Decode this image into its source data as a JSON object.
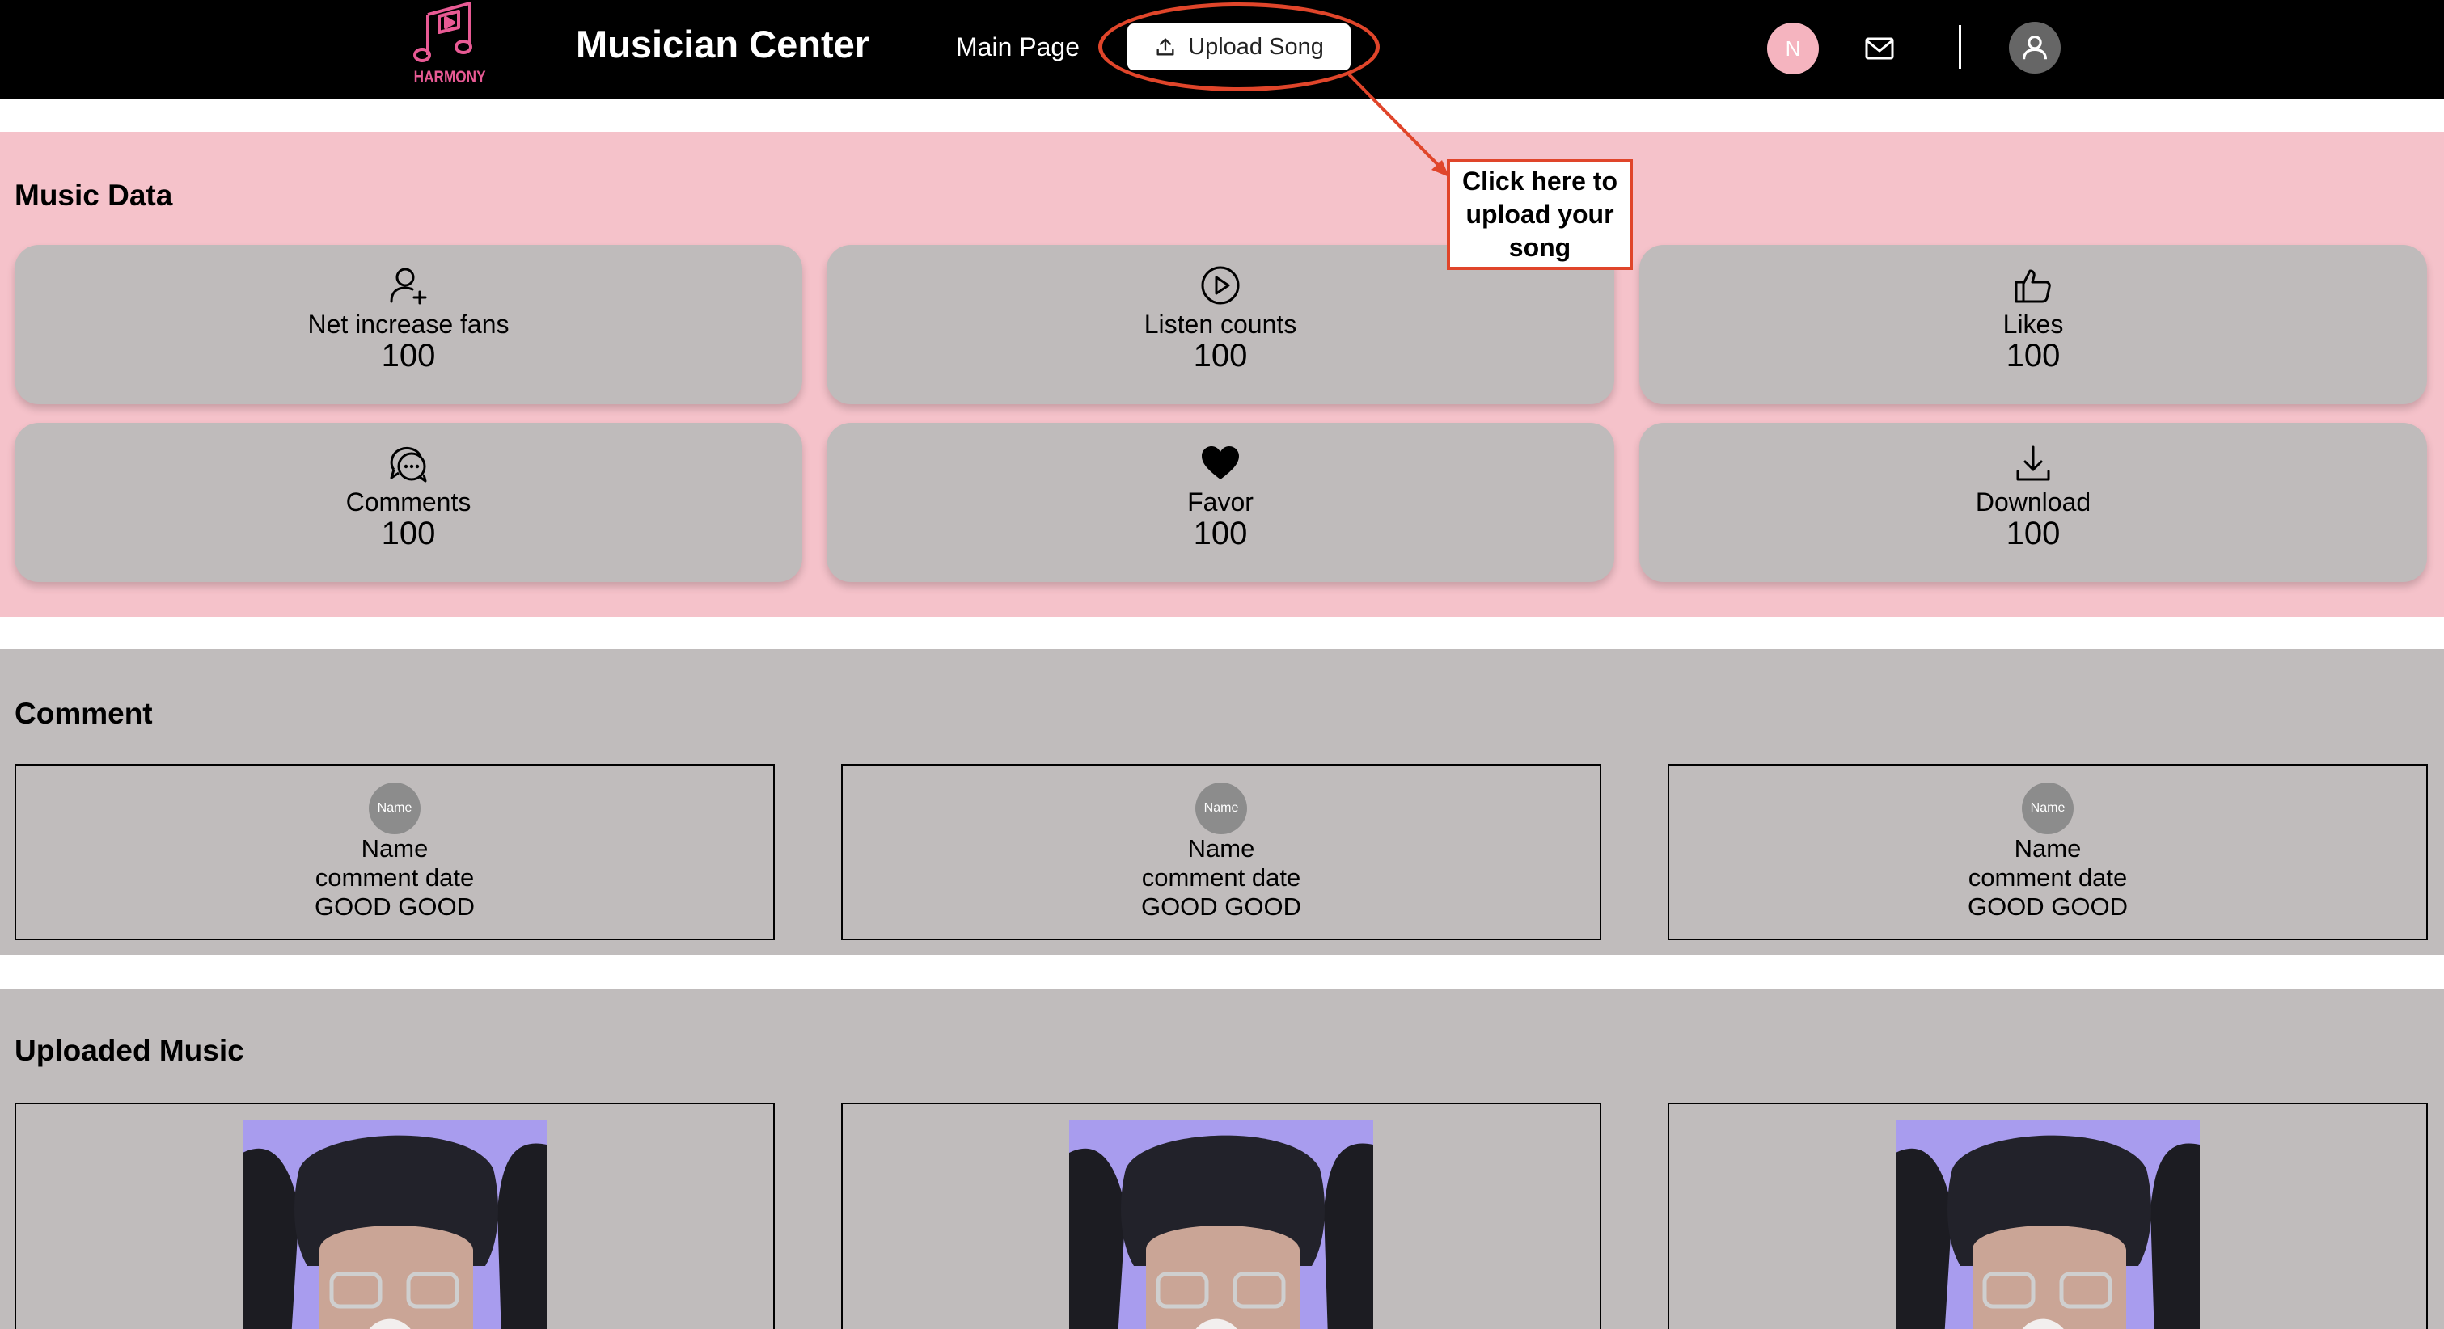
{
  "header": {
    "logo_text": "HARMONY",
    "app_title": "Musician Center",
    "nav_main": "Main Page",
    "upload_button": "Upload Song",
    "avatar_initial": "N"
  },
  "music_data": {
    "title": "Music Data",
    "stats": [
      {
        "icon": "user-plus-icon",
        "label": "Net increase fans",
        "value": "100"
      },
      {
        "icon": "play-circle-icon",
        "label": "Listen counts",
        "value": "100"
      },
      {
        "icon": "thumbs-up-icon",
        "label": "Likes",
        "value": "100"
      },
      {
        "icon": "chat-bubbles-icon",
        "label": "Comments",
        "value": "100"
      },
      {
        "icon": "heart-icon",
        "label": "Favor",
        "value": "100"
      },
      {
        "icon": "download-icon",
        "label": "Download",
        "value": "100"
      }
    ]
  },
  "comment": {
    "title": "Comment",
    "items": [
      {
        "avatar": "Name",
        "name": "Name",
        "date": "comment date",
        "text": "GOOD GOOD"
      },
      {
        "avatar": "Name",
        "name": "Name",
        "date": "comment date",
        "text": "GOOD GOOD"
      },
      {
        "avatar": "Name",
        "name": "Name",
        "date": "comment date",
        "text": "GOOD GOOD"
      }
    ]
  },
  "uploaded": {
    "title": "Uploaded Music"
  },
  "callout": {
    "text": "Click here to upload your song"
  },
  "colors": {
    "header_bg": "#000000",
    "music_section_bg": "#f5c2ca",
    "card_bg": "#bfbbbb",
    "accent_red": "#e0452a",
    "logo_pink": "#e85a94"
  }
}
